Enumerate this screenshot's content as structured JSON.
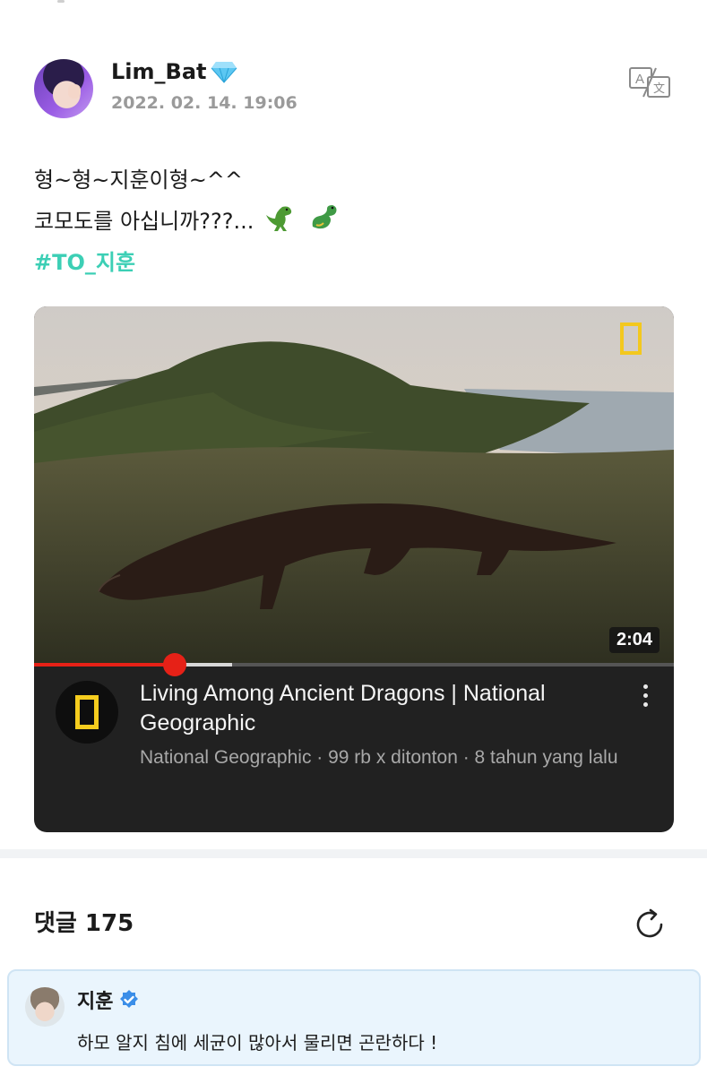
{
  "post": {
    "author": "Lim_Bat",
    "author_badge_icon": "diamond-icon",
    "timestamp": "2022. 02. 14. 19:06",
    "translate_icon": "translate-icon",
    "lines": [
      "형~형~지훈이형~^^",
      "코모도를 아십니까???..."
    ],
    "emojis": [
      "t-rex-emoji",
      "dragon-emoji"
    ],
    "hashtag": "#TO_지훈"
  },
  "video": {
    "duration": "2:04",
    "progress_played": 0.22,
    "progress_buffered": 0.31,
    "channel_logo_icon": "national-geographic-logo-icon",
    "title": "Living Among Ancient Dragons | National Geographic",
    "meta": "National Geographic · 99 rb x ditonton · 8 tahun yang lalu",
    "more_icon": "more-vertical-icon"
  },
  "comments": {
    "header": "댓글 175",
    "refresh_icon": "refresh-icon",
    "pinned": {
      "author": "지훈",
      "verified_icon": "verified-badge-icon",
      "text": "하모 알지 침에 세균이 많아서 물리면 곤란하다 !"
    }
  },
  "colors": {
    "hashtag": "#3ccfb5",
    "progress": "#e62117",
    "card_bg": "#212121",
    "comment_bg": "#eaf5fd",
    "verified": "#3b8ee8"
  }
}
